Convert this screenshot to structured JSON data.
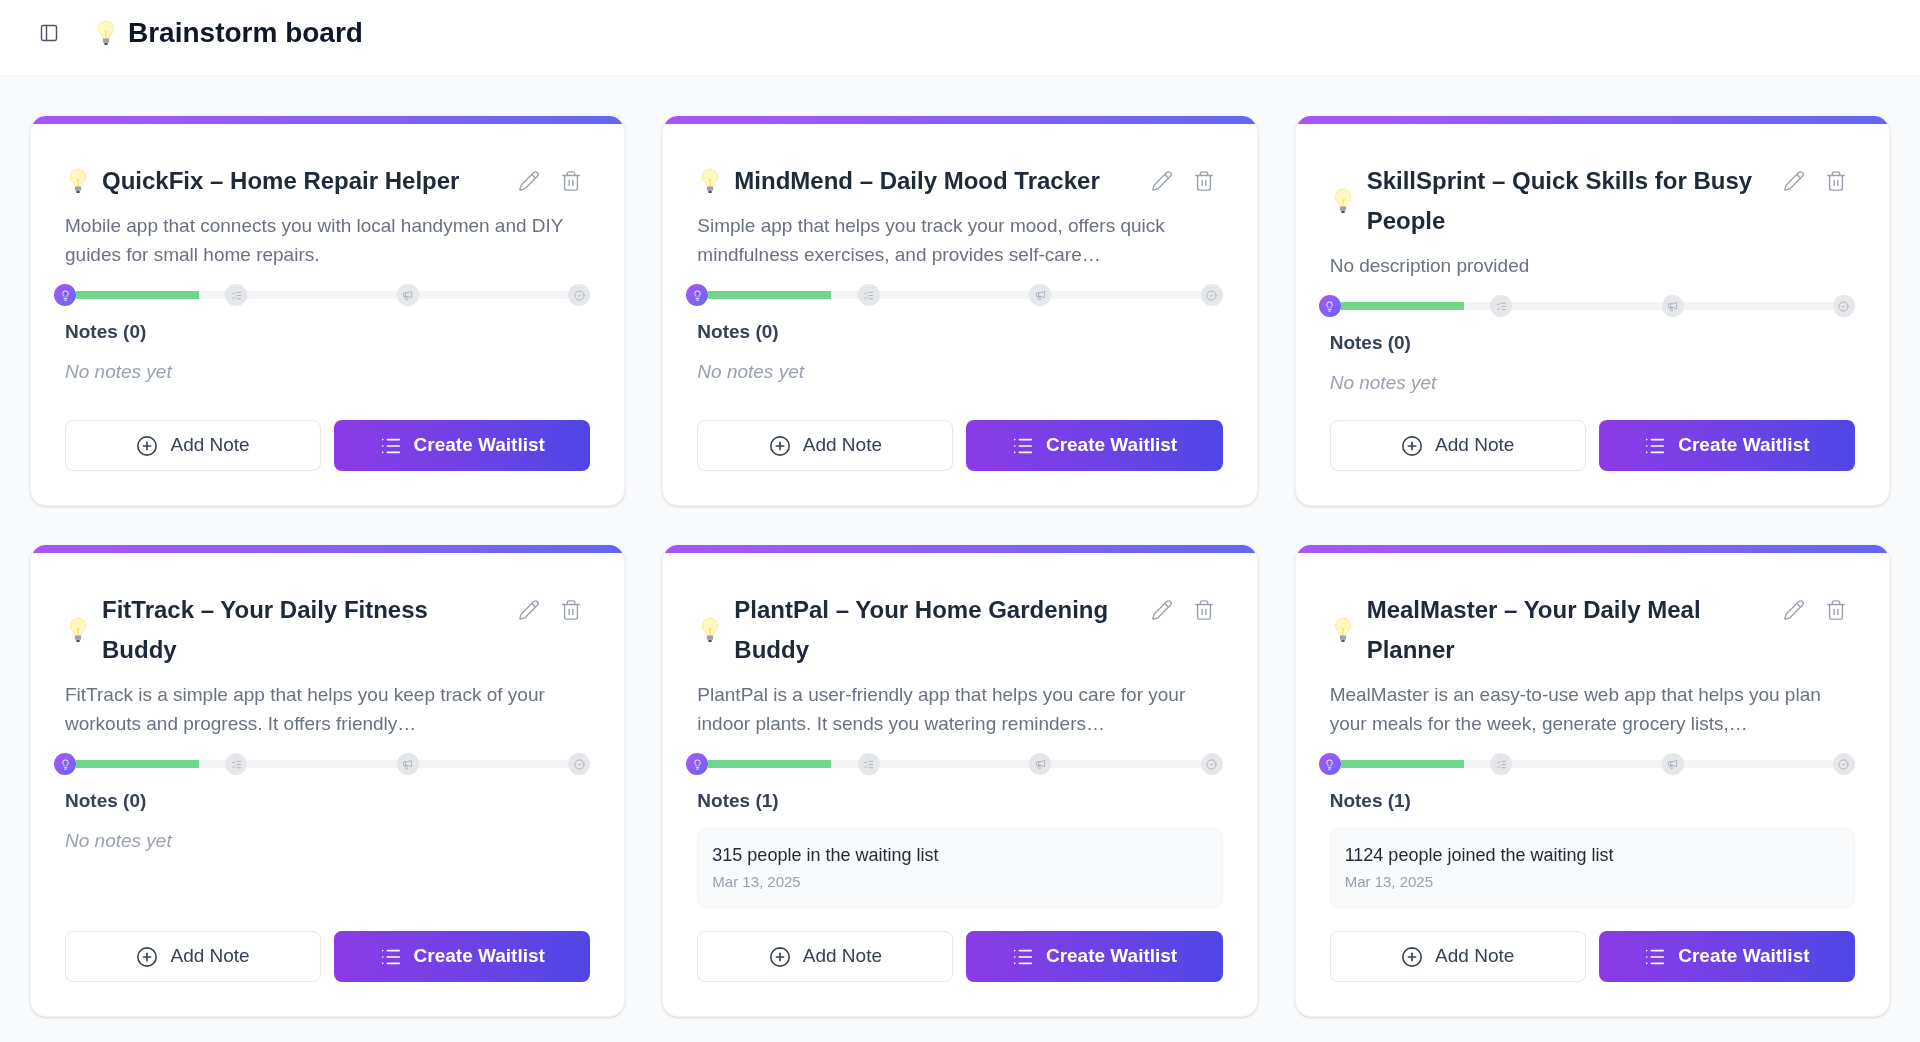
{
  "header": {
    "title": "Brainstorm board"
  },
  "cards": [
    {
      "title": "QuickFix – Home Repair Helper",
      "description": "Mobile app that connects you with local handymen and DIY guides for small home repairs.",
      "progress": {
        "level": 0.25,
        "stages": [
          {
            "active": true
          },
          {
            "active": false
          },
          {
            "active": false
          },
          {
            "active": false
          }
        ]
      },
      "notes_heading": "Notes (0)",
      "empty_text": "No notes yet",
      "buttons": [
        {
          "kind": "outline",
          "label": "Add Note"
        },
        {
          "kind": "primary",
          "label": "Create Waitlist"
        }
      ]
    },
    {
      "title": "MindMend – Daily Mood Tracker",
      "description": "Simple app that helps you track your mood, offers quick mindfulness exercises, and provides self-care…",
      "progress": {
        "level": 0.25,
        "stages": [
          {
            "active": true
          },
          {
            "active": false
          },
          {
            "active": false
          },
          {
            "active": false
          }
        ]
      },
      "notes_heading": "Notes (0)",
      "empty_text": "No notes yet",
      "buttons": [
        {
          "kind": "outline",
          "label": "Add Note"
        },
        {
          "kind": "primary",
          "label": "Create Waitlist"
        }
      ]
    },
    {
      "title": "SkillSprint – Quick Skills for Busy People",
      "description": "No description provided",
      "progress": {
        "level": 0.25,
        "stages": [
          {
            "active": true
          },
          {
            "active": false
          },
          {
            "active": false
          },
          {
            "active": false
          }
        ]
      },
      "notes_heading": "Notes (0)",
      "empty_text": "No notes yet",
      "buttons": [
        {
          "kind": "outline",
          "label": "Add Note"
        },
        {
          "kind": "primary",
          "label": "Create Waitlist"
        }
      ]
    },
    {
      "title": "FitTrack – Your Daily Fitness Buddy",
      "description": "FitTrack is a simple app that helps you keep track of your workouts and progress. It offers friendly…",
      "progress": {
        "level": 0.25,
        "stages": [
          {
            "active": true
          },
          {
            "active": false
          },
          {
            "active": false
          },
          {
            "active": false
          }
        ]
      },
      "notes_heading": "Notes (0)",
      "empty_text": "No notes yet",
      "buttons": [
        {
          "kind": "outline",
          "label": "Add Note"
        },
        {
          "kind": "primary",
          "label": "Create Waitlist"
        }
      ]
    },
    {
      "title": "PlantPal – Your Home Gardening Buddy",
      "description": "PlantPal is a user-friendly app that helps you care for your indoor plants. It sends you watering reminders…",
      "progress": {
        "level": 0.25,
        "stages": [
          {
            "active": true
          },
          {
            "active": false
          },
          {
            "active": false
          },
          {
            "active": false
          }
        ]
      },
      "notes_heading": "Notes (1)",
      "notes": [
        {
          "text": "315 people in the waiting list",
          "date": "Mar 13, 2025"
        }
      ],
      "buttons": [
        {
          "kind": "outline",
          "label": "Add Note"
        },
        {
          "kind": "primary",
          "label": "Create Waitlist"
        }
      ]
    },
    {
      "title": "MealMaster – Your Daily Meal Planner",
      "description": "MealMaster is an easy-to-use web app that helps you plan your meals for the week, generate grocery lists,…",
      "progress": {
        "level": 0.25,
        "stages": [
          {
            "active": true
          },
          {
            "active": false
          },
          {
            "active": false
          },
          {
            "active": false
          }
        ]
      },
      "notes_heading": "Notes (1)",
      "notes": [
        {
          "text": "1124 people joined the waiting list",
          "date": "Mar 13, 2025"
        }
      ],
      "buttons": [
        {
          "kind": "outline",
          "label": "Add Note"
        },
        {
          "kind": "primary",
          "label": "Create Waitlist"
        }
      ]
    }
  ]
}
